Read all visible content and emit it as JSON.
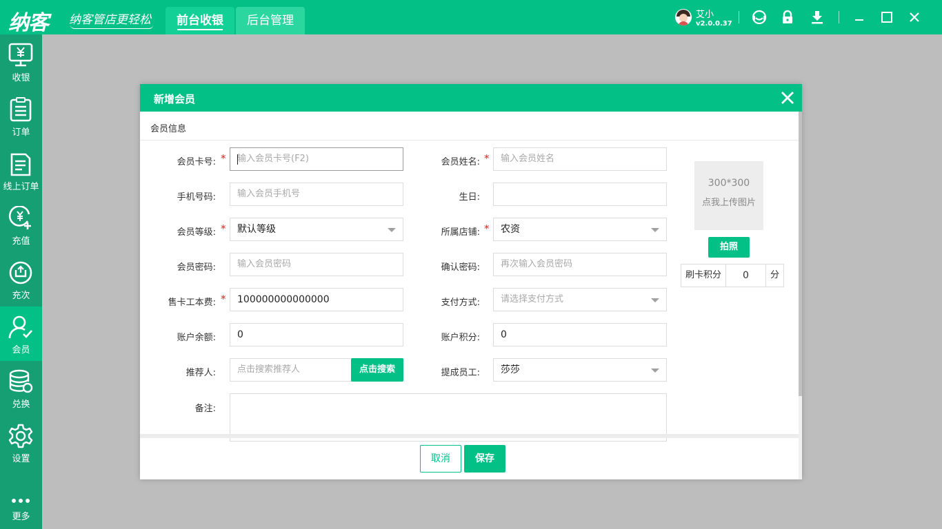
{
  "app": {
    "logo": "纳客",
    "slogan": "纳客管店更轻松",
    "tabs": [
      {
        "label": "前台收银",
        "active": true
      },
      {
        "label": "后台管理",
        "active": false
      }
    ],
    "user": {
      "name": "艾小",
      "version": "v2.0.0.37"
    },
    "icons": [
      "support-icon",
      "lock-icon",
      "download-icon",
      "minimize-icon",
      "maximize-icon",
      "close-icon"
    ]
  },
  "sidebar": {
    "items": [
      {
        "label": "收银",
        "icon": "cashier-icon"
      },
      {
        "label": "订单",
        "icon": "order-icon"
      },
      {
        "label": "线上订单",
        "icon": "online-order-icon"
      },
      {
        "label": "充值",
        "icon": "recharge-icon"
      },
      {
        "label": "充次",
        "icon": "recharge-times-icon"
      },
      {
        "label": "会员",
        "icon": "member-icon",
        "active": true
      },
      {
        "label": "兑换",
        "icon": "exchange-icon"
      },
      {
        "label": "设置",
        "icon": "settings-icon"
      },
      {
        "label": "更多",
        "icon": "more-icon"
      }
    ]
  },
  "modal": {
    "title": "新增会员",
    "section": "会员信息",
    "fields": {
      "card_no": {
        "label": "会员卡号:",
        "required": true,
        "placeholder": "输入会员卡号(F2)",
        "value": ""
      },
      "name": {
        "label": "会员姓名:",
        "required": true,
        "placeholder": "输入会员姓名",
        "value": ""
      },
      "phone": {
        "label": "手机号码:",
        "placeholder": "输入会员手机号",
        "value": ""
      },
      "birthday": {
        "label": "生日:",
        "value": ""
      },
      "level": {
        "label": "会员等级:",
        "required": true,
        "value": "默认等级"
      },
      "store": {
        "label": "所属店铺:",
        "required": true,
        "value": "农资"
      },
      "password": {
        "label": "会员密码:",
        "placeholder": "输入会员密码",
        "value": ""
      },
      "confirm_password": {
        "label": "确认密码:",
        "placeholder": "再次输入会员密码",
        "value": ""
      },
      "card_fee": {
        "label": "售卡工本费:",
        "required": true,
        "value": "100000000000000"
      },
      "payment": {
        "label": "支付方式:",
        "placeholder": "请选择支付方式",
        "value": ""
      },
      "balance": {
        "label": "账户余额:",
        "value": "0"
      },
      "points": {
        "label": "账户积分:",
        "value": "0"
      },
      "referrer": {
        "label": "推荐人:",
        "placeholder": "点击搜索推荐人",
        "button": "点击搜索"
      },
      "staff": {
        "label": "提成员工:",
        "value": "莎莎"
      },
      "memo": {
        "label": "备注:",
        "value": ""
      }
    },
    "photo": {
      "size": "300*300",
      "hint": "点我上传图片",
      "button": "拍照"
    },
    "swipe_points": {
      "label": "刷卡积分",
      "value": "0",
      "unit": "分"
    },
    "buttons": {
      "cancel": "取消",
      "save": "保存"
    }
  },
  "colors": {
    "brand": "#03c086",
    "sidebar": "#169f73",
    "required": "#e02020"
  }
}
